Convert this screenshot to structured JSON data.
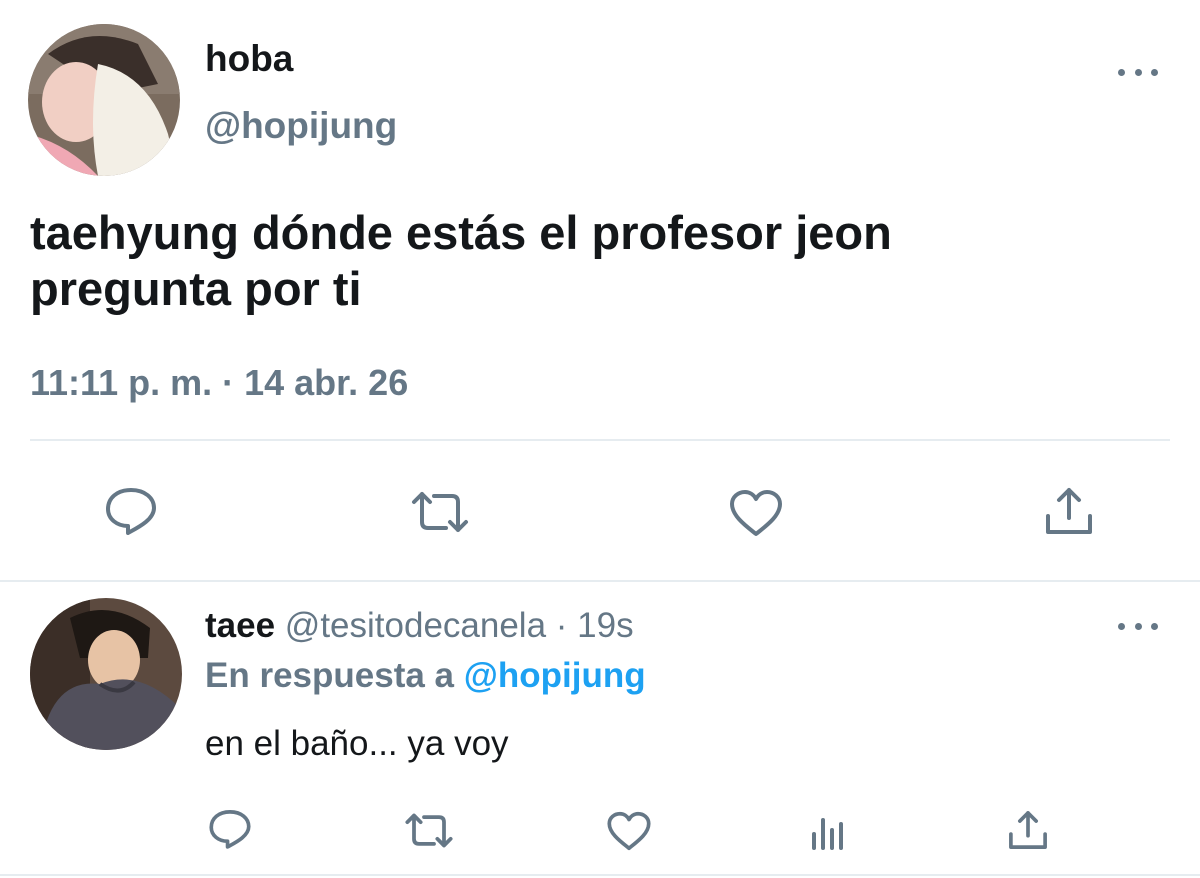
{
  "tweet": {
    "display_name": "hoba",
    "handle": "@hopijung",
    "text_line1": "taehyung dónde estás el profesor jeon",
    "text_line2": "pregunta por ti",
    "timestamp": "11:11 p. m. · 14 abr. 26",
    "avatar_icon": "user-avatar-photo",
    "actions": [
      "reply-icon",
      "retweet-icon",
      "like-icon",
      "share-icon"
    ]
  },
  "reply": {
    "display_name": "taee",
    "handle": "@tesitodecanela",
    "time": "· 19s",
    "reply_prefix": "En respuesta a",
    "reply_to": "@hopijung",
    "text": "en el baño... ya voy",
    "avatar_icon": "user-avatar-photo",
    "actions": [
      "reply-icon",
      "retweet-icon",
      "like-icon",
      "analytics-icon",
      "share-icon"
    ]
  },
  "colors": {
    "text": "#14171a",
    "muted": "#657786",
    "link": "#1da1f2",
    "divider": "#e6ecf0"
  }
}
